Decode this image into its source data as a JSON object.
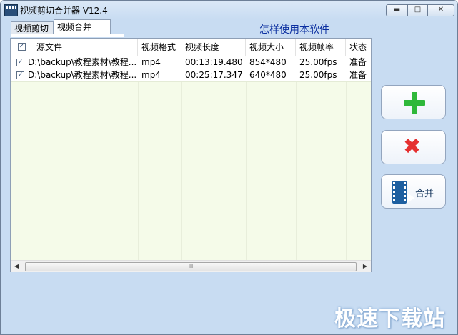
{
  "window": {
    "title": "视频剪切合并器 V12.4",
    "controls": {
      "minimize": "▬",
      "maximize": "□",
      "close": "✕"
    }
  },
  "tabs": [
    {
      "label": "视频剪切",
      "selected": false
    },
    {
      "label": "视频合并",
      "selected": true
    }
  ],
  "help_link": "怎样使用本软件",
  "table": {
    "header_checkbox": "✓",
    "columns": [
      "源文件",
      "视频格式",
      "视频长度",
      "视频大小",
      "视频帧率",
      "状态"
    ],
    "rows": [
      {
        "checked": "✓",
        "file": "D:\\backup\\教程素材\\教程...",
        "format": "mp4",
        "length": "00:13:19.480",
        "size": "854*480",
        "fps": "25.00fps",
        "status": "准备"
      },
      {
        "checked": "✓",
        "file": "D:\\backup\\教程素材\\教程...",
        "format": "mp4",
        "length": "00:25:17.347",
        "size": "640*480",
        "fps": "25.00fps",
        "status": "准备"
      }
    ],
    "scrollbar": {
      "left": "◀",
      "right": "▶",
      "grip": "III"
    }
  },
  "buttons": {
    "add_icon": "plus-icon",
    "delete_icon": "x-icon",
    "delete_glyph": "✖",
    "merge_label": "合并",
    "merge_icon": "film-play-icon"
  },
  "watermark": "极速下载站",
  "colors": {
    "window_bg": "#c8dcf2",
    "list_bg": "#f5fbe9",
    "add_green": "#2fb83a",
    "delete_red": "#e53030",
    "link_blue": "#0b2fa0"
  }
}
